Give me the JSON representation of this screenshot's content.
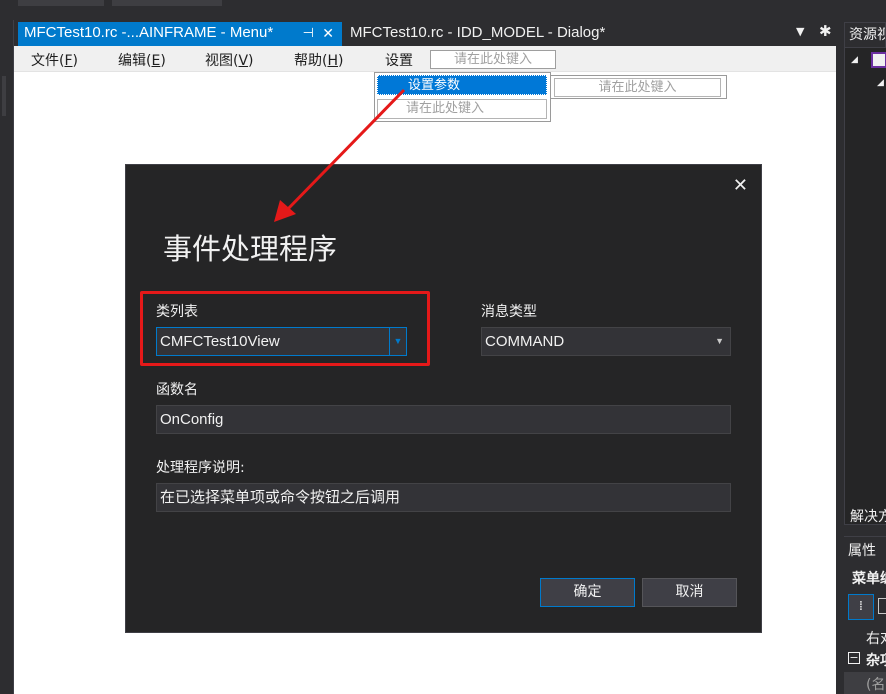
{
  "tabs": {
    "active": {
      "title": "MFCTest10.rc -...AINFRAME - Menu*",
      "pin": "⊣",
      "close": "✕"
    },
    "inactive": {
      "title": "MFCTest10.rc - IDD_MODEL - Dialog*"
    },
    "overflow_icon": "chevron-down-icon",
    "settings_icon": "gear-icon"
  },
  "menubar": {
    "items": [
      {
        "label": "文件(",
        "key": "F",
        "end": ")"
      },
      {
        "label": "编辑(",
        "key": "E",
        "end": ")"
      },
      {
        "label": "视图(",
        "key": "V",
        "end": ")"
      },
      {
        "label": "帮助(",
        "key": "H",
        "end": ")"
      }
    ],
    "settings_label": "设置",
    "type_here": "请在此处键入"
  },
  "dropdown": {
    "selected": "设置参数",
    "type_here": "请在此处键入",
    "submenu_type_here": "请在此处键入"
  },
  "dialog": {
    "title": "事件处理程序",
    "close_icon": "close-icon",
    "class_list_label": "类列表",
    "class_list_value": "CMFCTest10View",
    "message_type_label": "消息类型",
    "message_type_value": "COMMAND",
    "function_name_label": "函数名",
    "function_name_value": "OnConfig",
    "handler_desc_label": "处理程序说明:",
    "handler_desc_value": "在已选择菜单项或命令按钮之后调用",
    "ok_button": "确定",
    "cancel_button": "取消"
  },
  "right_panel": {
    "resource_view_title": "资源视",
    "solution_label": "解决方",
    "properties_title": "属性",
    "object_label": "菜单编",
    "right_label": "右对",
    "misc_label": "杂项",
    "name_label": "(名"
  },
  "annotations": {
    "highlight_color": "#e51919",
    "accent_color": "#007acc"
  }
}
